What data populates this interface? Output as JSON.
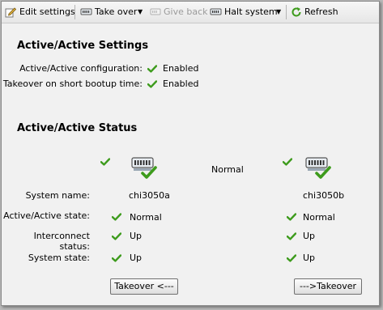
{
  "toolbar": {
    "edit_settings": "Edit settings",
    "take_over": "Take over",
    "give_back": "Give back",
    "halt_system": "Halt system",
    "refresh": "Refresh"
  },
  "settings": {
    "title": "Active/Active Settings",
    "rows": [
      {
        "label": "Active/Active configuration:",
        "value": "Enabled"
      },
      {
        "label": "Takeover on short bootup time:",
        "value": "Enabled"
      }
    ]
  },
  "status": {
    "title": "Active/Active Status",
    "link_state": "Normal",
    "labels": {
      "system_name": "System name:",
      "aa_state": "Active/Active state:",
      "interconnect": "Interconnect status:",
      "system_state": "System state:"
    },
    "node_a": {
      "system_name": "chi3050a",
      "aa_state": "Normal",
      "interconnect": "Up",
      "system_state": "Up"
    },
    "node_b": {
      "system_name": "chi3050b",
      "aa_state": "Normal",
      "interconnect": "Up",
      "system_state": "Up"
    }
  },
  "buttons": {
    "takeover_a": "Takeover <---",
    "takeover_b": "--->Takeover"
  },
  "colors": {
    "check": "#3d9b1c",
    "server_blue": "#4e79a7"
  }
}
